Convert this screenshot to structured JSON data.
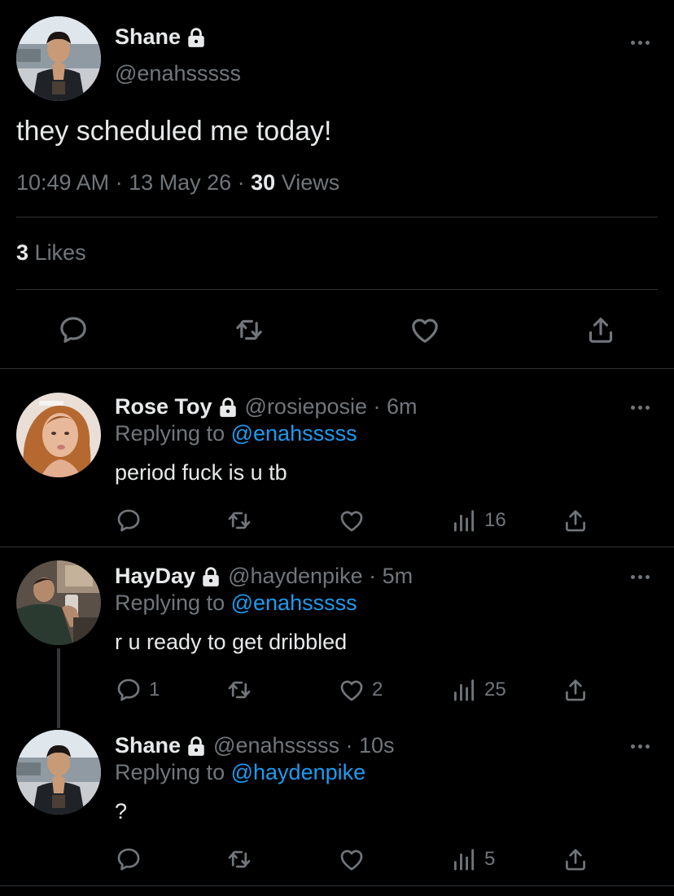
{
  "main_tweet": {
    "name": "Shane",
    "handle": "@enahsssss",
    "text": "they scheduled me today!",
    "time": "10:49 AM",
    "date": "13 May 26",
    "views_count": "30",
    "views_label": "Views",
    "likes_count": "3",
    "likes_label": "Likes",
    "icons": [
      "lock-icon",
      "more-icon",
      "reply-icon",
      "retweet-icon",
      "like-icon",
      "share-icon"
    ]
  },
  "replies": [
    {
      "name": "Rose Toy",
      "handle": "@rosieposie",
      "time": "6m",
      "replying_label": "Replying to",
      "replying_to": "@enahsssss",
      "text": "period fuck is u tb",
      "reply_count": "",
      "retweet_count": "",
      "like_count": "",
      "view_count": "16"
    },
    {
      "name": "HayDay",
      "handle": "@haydenpike",
      "time": "5m",
      "replying_label": "Replying to",
      "replying_to": "@enahsssss",
      "text": "r u ready to get dribbled",
      "reply_count": "1",
      "retweet_count": "",
      "like_count": "2",
      "view_count": "25"
    },
    {
      "name": "Shane",
      "handle": "@enahsssss",
      "time": "10s",
      "replying_label": "Replying to",
      "replying_to": "@haydenpike",
      "text": "?",
      "reply_count": "",
      "retweet_count": "",
      "like_count": "",
      "view_count": "5"
    }
  ],
  "colors": {
    "background": "#000000",
    "text": "#e7e9ea",
    "secondary": "#71767b",
    "link": "#1d9bf0",
    "divider": "#2f3336"
  }
}
